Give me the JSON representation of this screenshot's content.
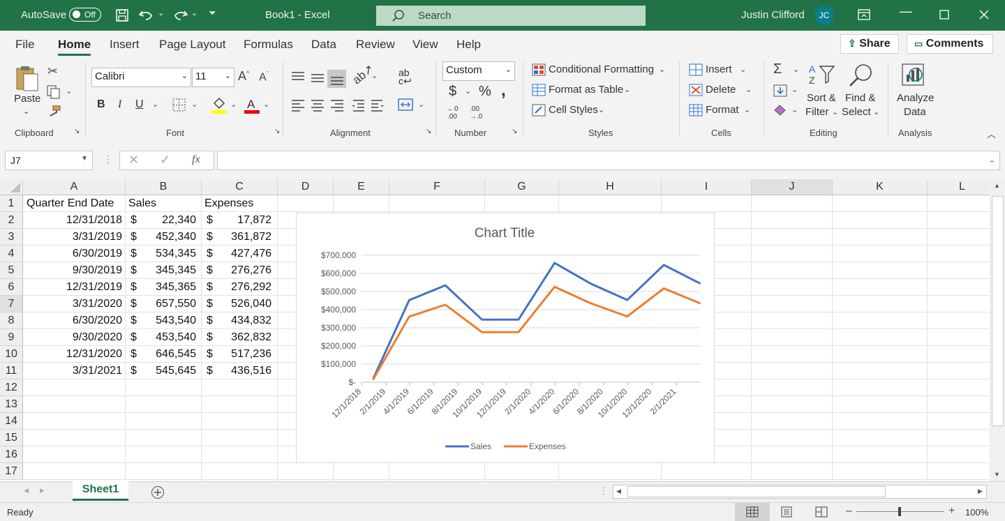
{
  "titlebar": {
    "autosave_label": "AutoSave",
    "autosave_state": "Off",
    "doc_title": "Book1  -  Excel",
    "search_placeholder": "Search",
    "user_name": "Justin Clifford",
    "user_initials": "JC"
  },
  "menu": {
    "tabs": [
      "File",
      "Home",
      "Insert",
      "Page Layout",
      "Formulas",
      "Data",
      "Review",
      "View",
      "Help"
    ],
    "active": "Home",
    "share_label": "Share",
    "comments_label": "Comments"
  },
  "ribbon": {
    "clipboard": {
      "paste_label": "Paste",
      "group_label": "Clipboard"
    },
    "font": {
      "font_name": "Calibri",
      "font_size": "11",
      "group_label": "Font",
      "bold": "B",
      "italic": "I",
      "underline": "U"
    },
    "alignment": {
      "group_label": "Alignment"
    },
    "number": {
      "format": "Custom",
      "group_label": "Number",
      "currency": "$",
      "percent": "%",
      "comma": ","
    },
    "styles": {
      "conditional_formatting": "Conditional Formatting",
      "format_as_table": "Format as Table",
      "cell_styles": "Cell Styles",
      "group_label": "Styles"
    },
    "cells": {
      "insert": "Insert",
      "delete": "Delete",
      "format": "Format",
      "group_label": "Cells"
    },
    "editing": {
      "sort_filter_1": "Sort &",
      "sort_filter_2": "Filter",
      "find_select_1": "Find &",
      "find_select_2": "Select",
      "group_label": "Editing"
    },
    "analysis": {
      "analyze_1": "Analyze",
      "analyze_2": "Data",
      "group_label": "Analysis"
    }
  },
  "formula_bar": {
    "name_box": "J7",
    "fx": "fx",
    "formula": ""
  },
  "sheet": {
    "columns": [
      "A",
      "B",
      "C",
      "D",
      "E",
      "F",
      "G",
      "H",
      "I",
      "J",
      "K",
      "L"
    ],
    "rows": [
      "1",
      "2",
      "3",
      "4",
      "5",
      "6",
      "7",
      "8",
      "9",
      "10",
      "11",
      "12",
      "13",
      "14",
      "15",
      "16",
      "17"
    ],
    "headers": {
      "a": "Quarter End Date",
      "b": "Sales",
      "c": "Expenses"
    },
    "data": [
      {
        "date": "12/31/2018",
        "sales": "22,340",
        "expenses": "17,872"
      },
      {
        "date": "3/31/2019",
        "sales": "452,340",
        "expenses": "361,872"
      },
      {
        "date": "6/30/2019",
        "sales": "534,345",
        "expenses": "427,476"
      },
      {
        "date": "9/30/2019",
        "sales": "345,345",
        "expenses": "276,276"
      },
      {
        "date": "12/31/2019",
        "sales": "345,365",
        "expenses": "276,292"
      },
      {
        "date": "3/31/2020",
        "sales": "657,550",
        "expenses": "526,040"
      },
      {
        "date": "6/30/2020",
        "sales": "543,540",
        "expenses": "434,832"
      },
      {
        "date": "9/30/2020",
        "sales": "453,540",
        "expenses": "362,832"
      },
      {
        "date": "12/31/2020",
        "sales": "646,545",
        "expenses": "517,236"
      },
      {
        "date": "3/31/2021",
        "sales": "545,645",
        "expenses": "436,516"
      }
    ],
    "currency_symbol": "$"
  },
  "chart_data": {
    "type": "line",
    "title": "Chart Title",
    "x_dates": [
      "2018-12-31",
      "2019-03-31",
      "2019-06-30",
      "2019-09-30",
      "2019-12-31",
      "2020-03-31",
      "2020-06-30",
      "2020-09-30",
      "2020-12-31",
      "2021-03-31"
    ],
    "x_tick_labels": [
      "12/1/2018",
      "2/1/2019",
      "4/1/2019",
      "6/1/2019",
      "8/1/2019",
      "10/1/2019",
      "12/1/2019",
      "2/1/2020",
      "4/1/2020",
      "6/1/2020",
      "8/1/2020",
      "10/1/2020",
      "12/1/2020",
      "2/1/2021"
    ],
    "x_ticks": [
      "2018-12-01",
      "2019-02-01",
      "2019-04-01",
      "2019-06-01",
      "2019-08-01",
      "2019-10-01",
      "2019-12-01",
      "2020-02-01",
      "2020-04-01",
      "2020-06-01",
      "2020-08-01",
      "2020-10-01",
      "2020-12-01",
      "2021-02-01"
    ],
    "y_tick_labels": [
      "$-",
      "$100,000",
      "$200,000",
      "$300,000",
      "$400,000",
      "$500,000",
      "$600,000",
      "$700,000"
    ],
    "y_ticks": [
      0,
      100000,
      200000,
      300000,
      400000,
      500000,
      600000,
      700000
    ],
    "ylim": [
      0,
      700000
    ],
    "xlim": [
      "2018-12-01",
      "2021-04-01"
    ],
    "series": [
      {
        "name": "Sales",
        "color": "#4472C4",
        "values": [
          22340,
          452340,
          534345,
          345345,
          345365,
          657550,
          543540,
          453540,
          646545,
          545645
        ]
      },
      {
        "name": "Expenses",
        "color": "#ED7D31",
        "values": [
          17872,
          361872,
          427476,
          276276,
          276292,
          526040,
          434832,
          362832,
          517236,
          436516
        ]
      }
    ],
    "grid": true,
    "legend": "bottom"
  },
  "sheet_tabs": {
    "active": "Sheet1"
  },
  "status": {
    "ready": "Ready",
    "zoom": "100%"
  },
  "colors": {
    "excel_green": "#217346",
    "accent_teal": "#0a7d8c"
  }
}
